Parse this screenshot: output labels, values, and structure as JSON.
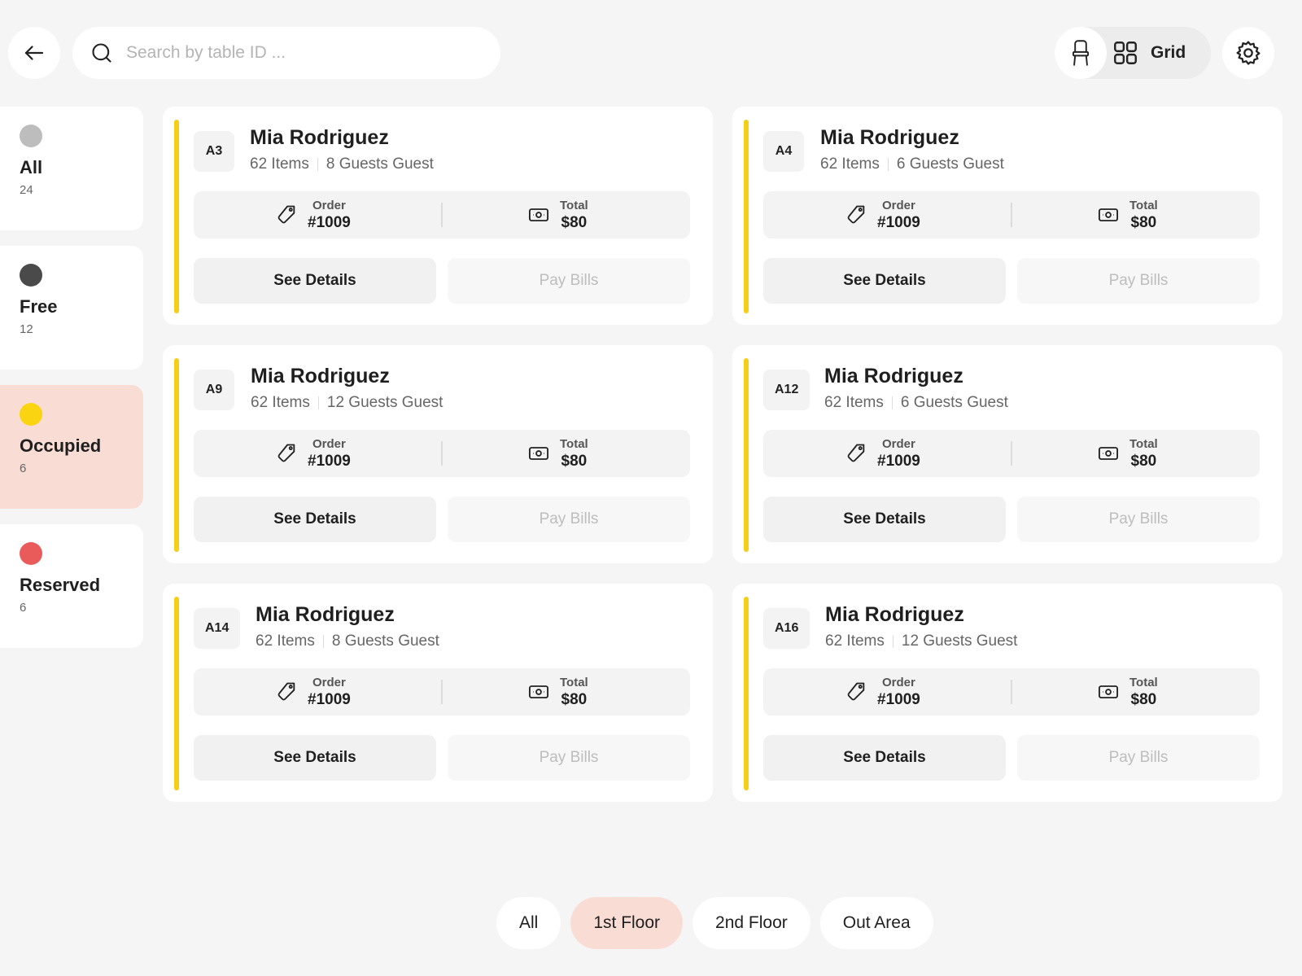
{
  "search": {
    "placeholder": "Search by table ID ..."
  },
  "view_toggle": {
    "grid_label": "Grid"
  },
  "colors": {
    "all": "#bdbdbd",
    "free": "#4a4a4a",
    "occupied": "#fbd411",
    "reserved": "#e95b5b",
    "accent_bar": "#f4cf16",
    "active_bg": "#f9ddd4"
  },
  "filters": [
    {
      "label": "All",
      "count": "24",
      "color": "#bdbdbd",
      "active": false
    },
    {
      "label": "Free",
      "count": "12",
      "color": "#4a4a4a",
      "active": false
    },
    {
      "label": "Occupied",
      "count": "6",
      "color": "#fbd411",
      "active": true
    },
    {
      "label": "Reserved",
      "count": "6",
      "color": "#e95b5b",
      "active": false
    }
  ],
  "cards": [
    {
      "table_id": "A3",
      "name": "Mia Rodriguez",
      "items": "62 Items",
      "guests": "8 Guests Guest",
      "order_label": "Order",
      "order": "#1009",
      "total_label": "Total",
      "total": "$80",
      "details_label": "See Details",
      "pay_label": "Pay Bills"
    },
    {
      "table_id": "A4",
      "name": "Mia Rodriguez",
      "items": "62 Items",
      "guests": "6 Guests Guest",
      "order_label": "Order",
      "order": "#1009",
      "total_label": "Total",
      "total": "$80",
      "details_label": "See Details",
      "pay_label": "Pay Bills"
    },
    {
      "table_id": "A9",
      "name": "Mia Rodriguez",
      "items": "62 Items",
      "guests": "12 Guests Guest",
      "order_label": "Order",
      "order": "#1009",
      "total_label": "Total",
      "total": "$80",
      "details_label": "See Details",
      "pay_label": "Pay Bills"
    },
    {
      "table_id": "A12",
      "name": "Mia Rodriguez",
      "items": "62 Items",
      "guests": "6 Guests Guest",
      "order_label": "Order",
      "order": "#1009",
      "total_label": "Total",
      "total": "$80",
      "details_label": "See Details",
      "pay_label": "Pay Bills"
    },
    {
      "table_id": "A14",
      "name": "Mia Rodriguez",
      "items": "62 Items",
      "guests": "8 Guests Guest",
      "order_label": "Order",
      "order": "#1009",
      "total_label": "Total",
      "total": "$80",
      "details_label": "See Details",
      "pay_label": "Pay Bills"
    },
    {
      "table_id": "A16",
      "name": "Mia Rodriguez",
      "items": "62 Items",
      "guests": "12 Guests Guest",
      "order_label": "Order",
      "order": "#1009",
      "total_label": "Total",
      "total": "$80",
      "details_label": "See Details",
      "pay_label": "Pay Bills"
    }
  ],
  "floor_tabs": [
    {
      "label": "All",
      "active": false
    },
    {
      "label": "1st Floor",
      "active": true
    },
    {
      "label": "2nd Floor",
      "active": false
    },
    {
      "label": "Out Area",
      "active": false
    }
  ],
  "icons": {
    "back": "arrow-left-icon",
    "search": "search-icon",
    "chair": "chair-icon",
    "grid": "grid-icon",
    "settings": "gear-icon",
    "order": "tag-icon",
    "total": "cash-icon"
  }
}
